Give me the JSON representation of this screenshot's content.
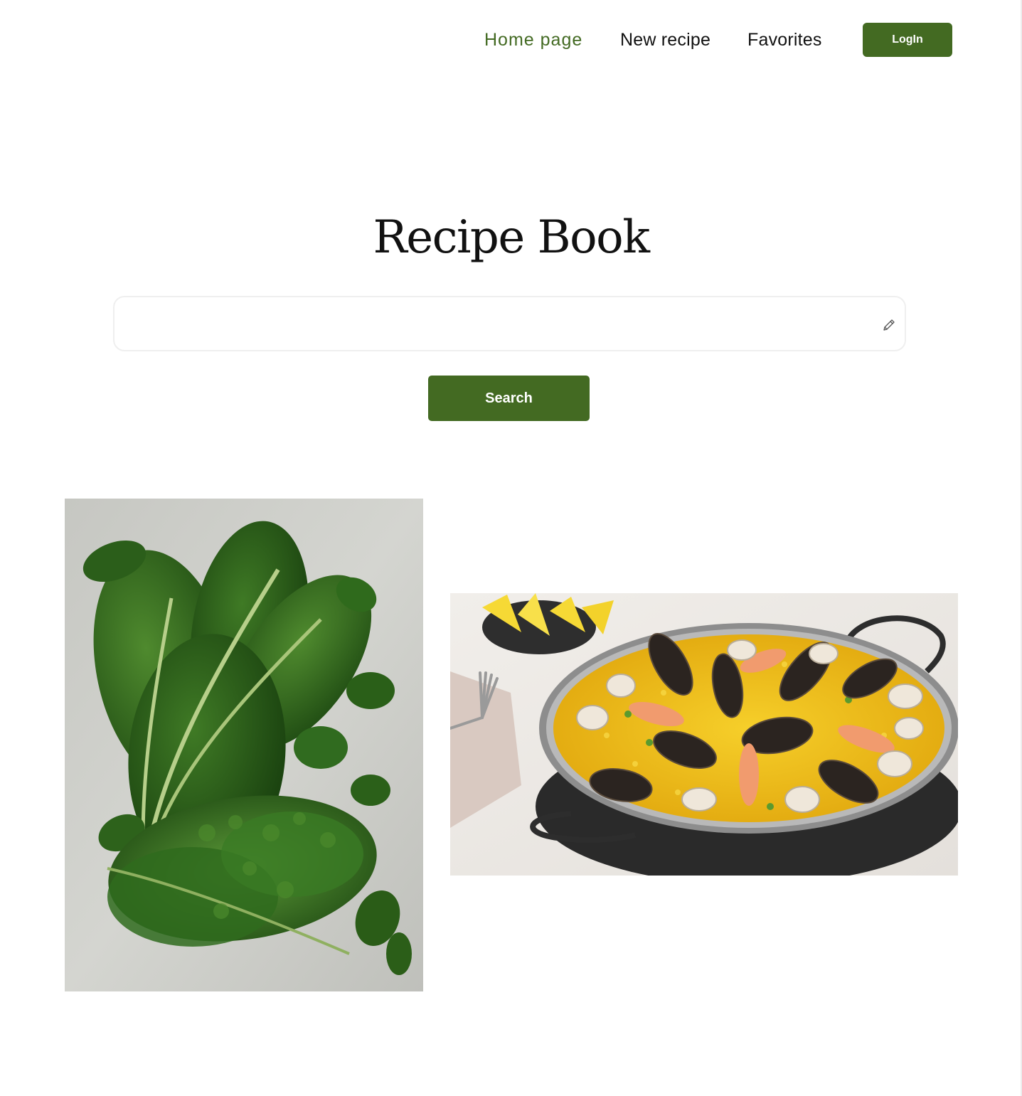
{
  "nav": {
    "home": "Home page",
    "new_recipe": "New recipe",
    "favorites": "Favorites",
    "login": "LogIn"
  },
  "hero": {
    "title": "Recipe Book"
  },
  "search": {
    "value": "",
    "button": "Search"
  },
  "colors": {
    "accent": "#436a22",
    "active_nav": "#436a22",
    "text": "#111111",
    "background": "#ffffff"
  },
  "icons": {
    "search_field": "pencil-icon"
  },
  "recipes": [
    {
      "image": "leafy-greens-photo"
    },
    {
      "image": "seafood-paella-photo"
    }
  ]
}
